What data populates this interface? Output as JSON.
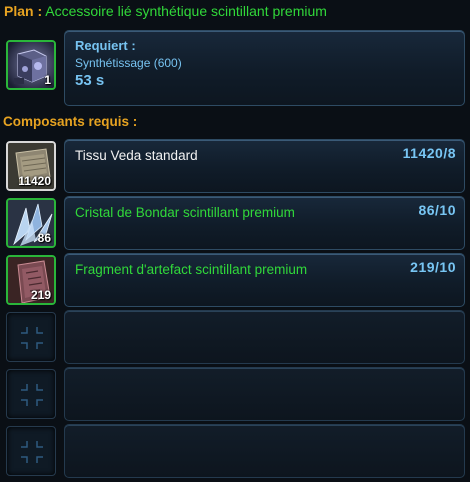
{
  "header": {
    "plan_label": "Plan :",
    "plan_name": "Accessoire lié synthétique scintillant premium"
  },
  "plan_item": {
    "icon": "synthetic-accessory-icon",
    "count": "1"
  },
  "requirements": {
    "title": "Requiert :",
    "skill": "Synthétissage (600)",
    "time": "53 s"
  },
  "components_section": {
    "title": "Composants requis :"
  },
  "components": [
    {
      "icon": "veda-cloth-icon",
      "stack": "11420",
      "name": "Tissu Veda standard",
      "quantity": "11420/8",
      "rarity_color": "#f2f2f2"
    },
    {
      "icon": "bondar-crystal-icon",
      "stack": "86",
      "name": "Cristal de Bondar scintillant premium",
      "quantity": "86/10",
      "rarity_color": "#31d83a"
    },
    {
      "icon": "artifact-fragment-icon",
      "stack": "219",
      "name": "Fragment d'artefact scintillant premium",
      "quantity": "219/10",
      "rarity_color": "#31d83a"
    }
  ],
  "empty_slots": 3,
  "colors": {
    "plan_label": "#e7a321",
    "premium_green": "#31d83a",
    "requirement_blue": "#77c3f1",
    "quantity_blue": "#78c6f4"
  }
}
